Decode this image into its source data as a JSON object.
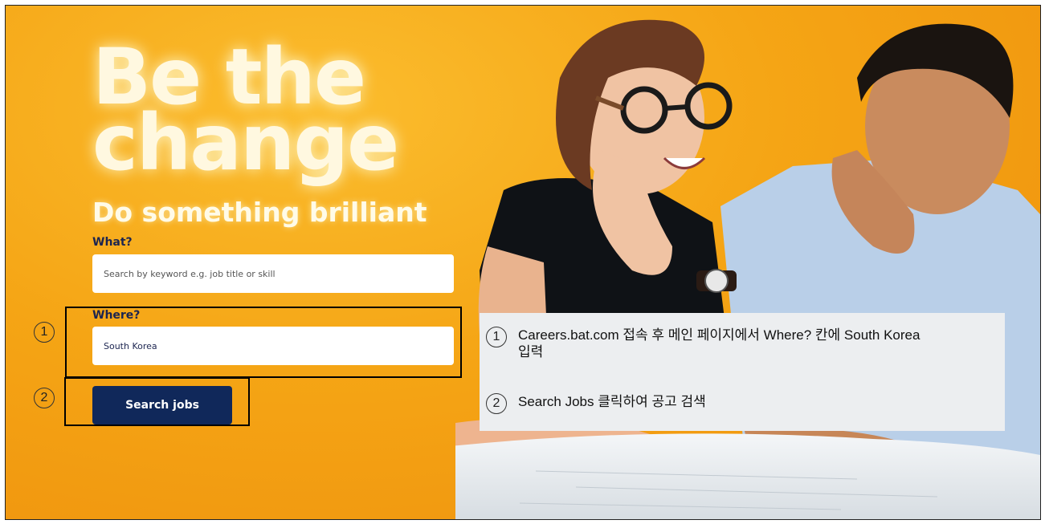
{
  "hero": {
    "headline_line1": "Be the",
    "headline_line2": "change",
    "subheadline": "Do something brilliant"
  },
  "search": {
    "what_label": "What?",
    "what_placeholder": "Search by keyword e.g. job title or skill",
    "where_label": "Where?",
    "where_value": "South Korea",
    "search_button_label": "Search jobs"
  },
  "markers": {
    "step1": "1",
    "step2": "2"
  },
  "annotation": {
    "step1_text": "Careers.bat.com 접속 후 메인 페이지에서 Where? 칸에 South Korea 입력",
    "step2_text": "Search Jobs 클릭하여 공고 검색"
  },
  "colors": {
    "background": "#f5a515",
    "button": "#10285a",
    "label": "#1c2550"
  }
}
